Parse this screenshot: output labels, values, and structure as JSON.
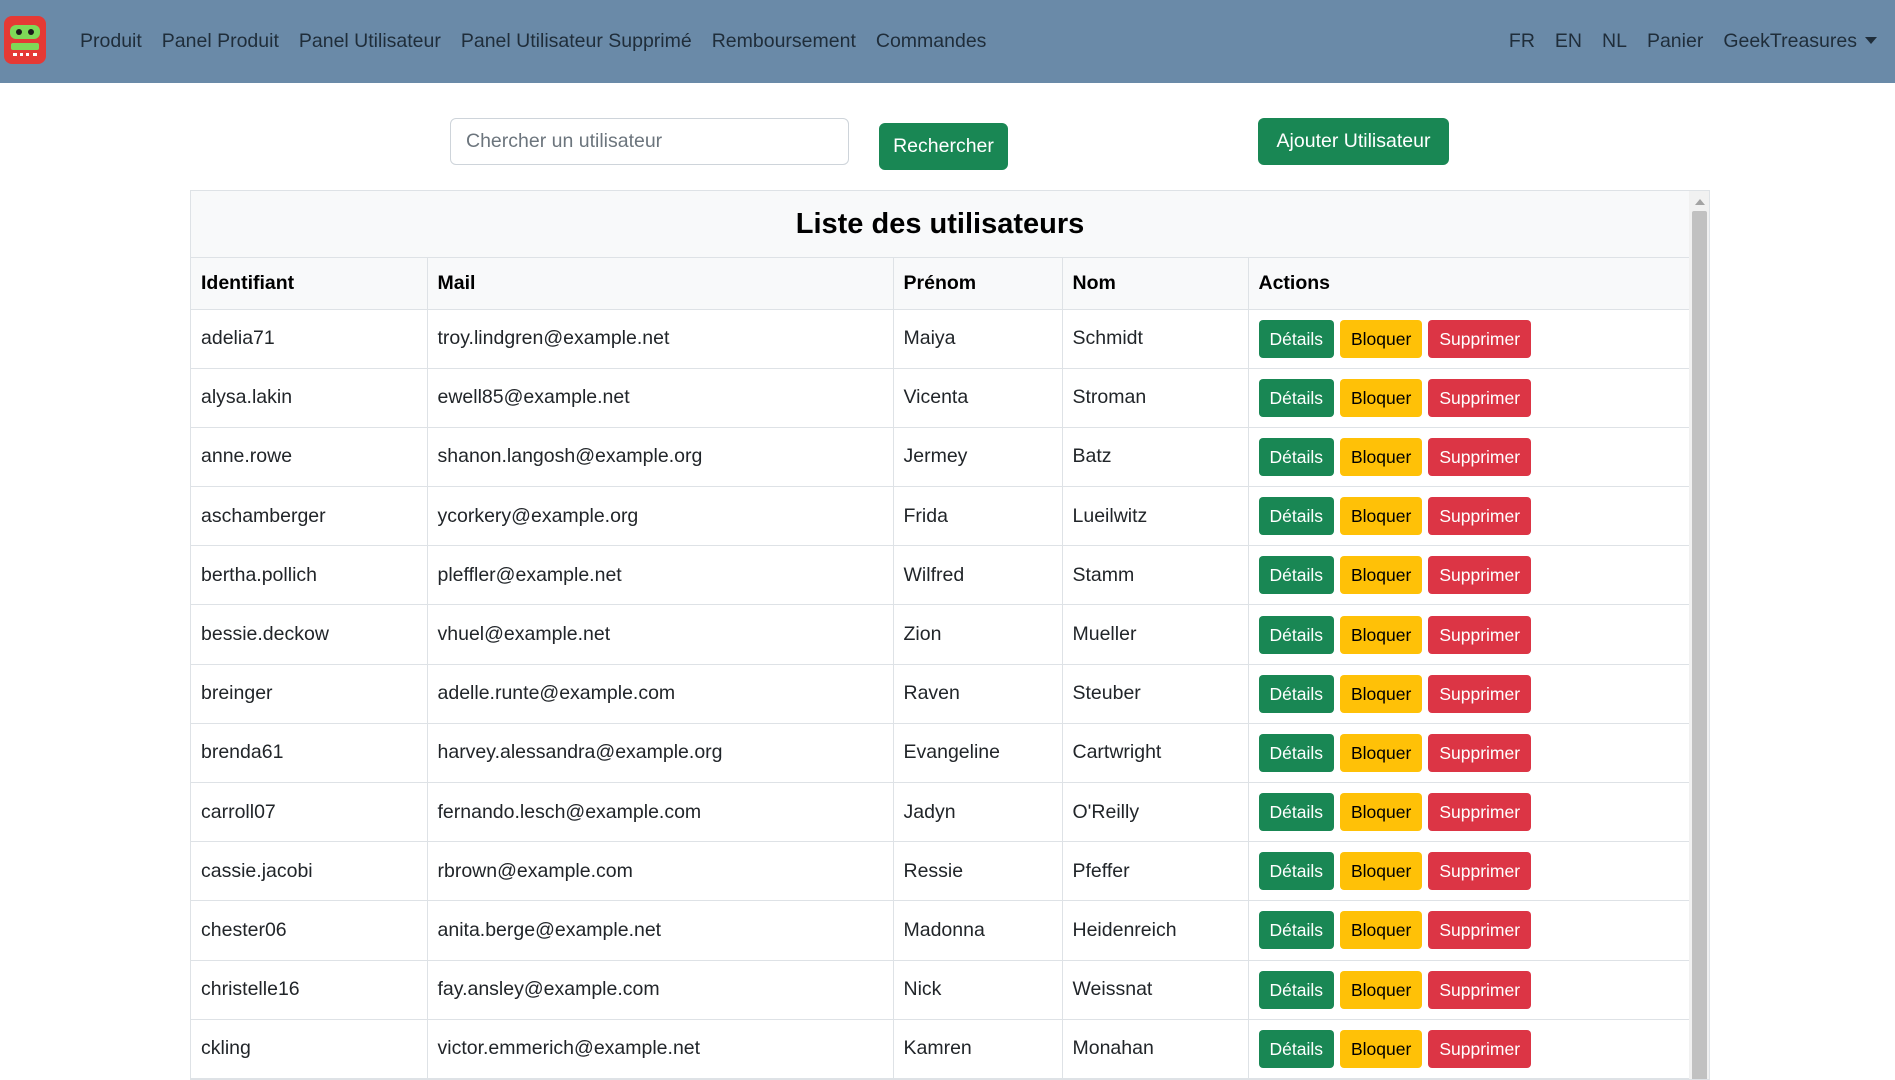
{
  "nav": {
    "left_links": [
      "Produit",
      "Panel Produit",
      "Panel Utilisateur",
      "Panel Utilisateur Supprimé",
      "Remboursement",
      "Commandes"
    ],
    "right_links": [
      "FR",
      "EN",
      "NL",
      "Panier"
    ],
    "user_menu": "GeekTreasures"
  },
  "search": {
    "placeholder": "Chercher un utilisateur",
    "button_label": "Rechercher"
  },
  "add_user_label": "Ajouter Utilisateur",
  "table": {
    "title": "Liste des utilisateurs",
    "columns": [
      "Identifiant",
      "Mail",
      "Prénom",
      "Nom",
      "Actions"
    ],
    "actions": {
      "details": "Détails",
      "block": "Bloquer",
      "delete": "Supprimer"
    },
    "rows": [
      [
        "adelia71",
        "troy.lindgren@example.net",
        "Maiya",
        "Schmidt"
      ],
      [
        "alysa.lakin",
        "ewell85@example.net",
        "Vicenta",
        "Stroman"
      ],
      [
        "anne.rowe",
        "shanon.langosh@example.org",
        "Jermey",
        "Batz"
      ],
      [
        "aschamberger",
        "ycorkery@example.org",
        "Frida",
        "Lueilwitz"
      ],
      [
        "bertha.pollich",
        "pleffler@example.net",
        "Wilfred",
        "Stamm"
      ],
      [
        "bessie.deckow",
        "vhuel@example.net",
        "Zion",
        "Mueller"
      ],
      [
        "breinger",
        "adelle.runte@example.com",
        "Raven",
        "Steuber"
      ],
      [
        "brenda61",
        "harvey.alessandra@example.org",
        "Evangeline",
        "Cartwright"
      ],
      [
        "carroll07",
        "fernando.lesch@example.com",
        "Jadyn",
        "O'Reilly"
      ],
      [
        "cassie.jacobi",
        "rbrown@example.com",
        "Ressie",
        "Pfeffer"
      ],
      [
        "chester06",
        "anita.berge@example.net",
        "Madonna",
        "Heidenreich"
      ],
      [
        "christelle16",
        "fay.ansley@example.com",
        "Nick",
        "Weissnat"
      ],
      [
        "ckling",
        "victor.emmerich@example.net",
        "Kamren",
        "Monahan"
      ]
    ]
  },
  "colors": {
    "navbar": "#6a8aa8",
    "success": "#198754",
    "warning": "#ffc107",
    "danger": "#dc3545"
  }
}
